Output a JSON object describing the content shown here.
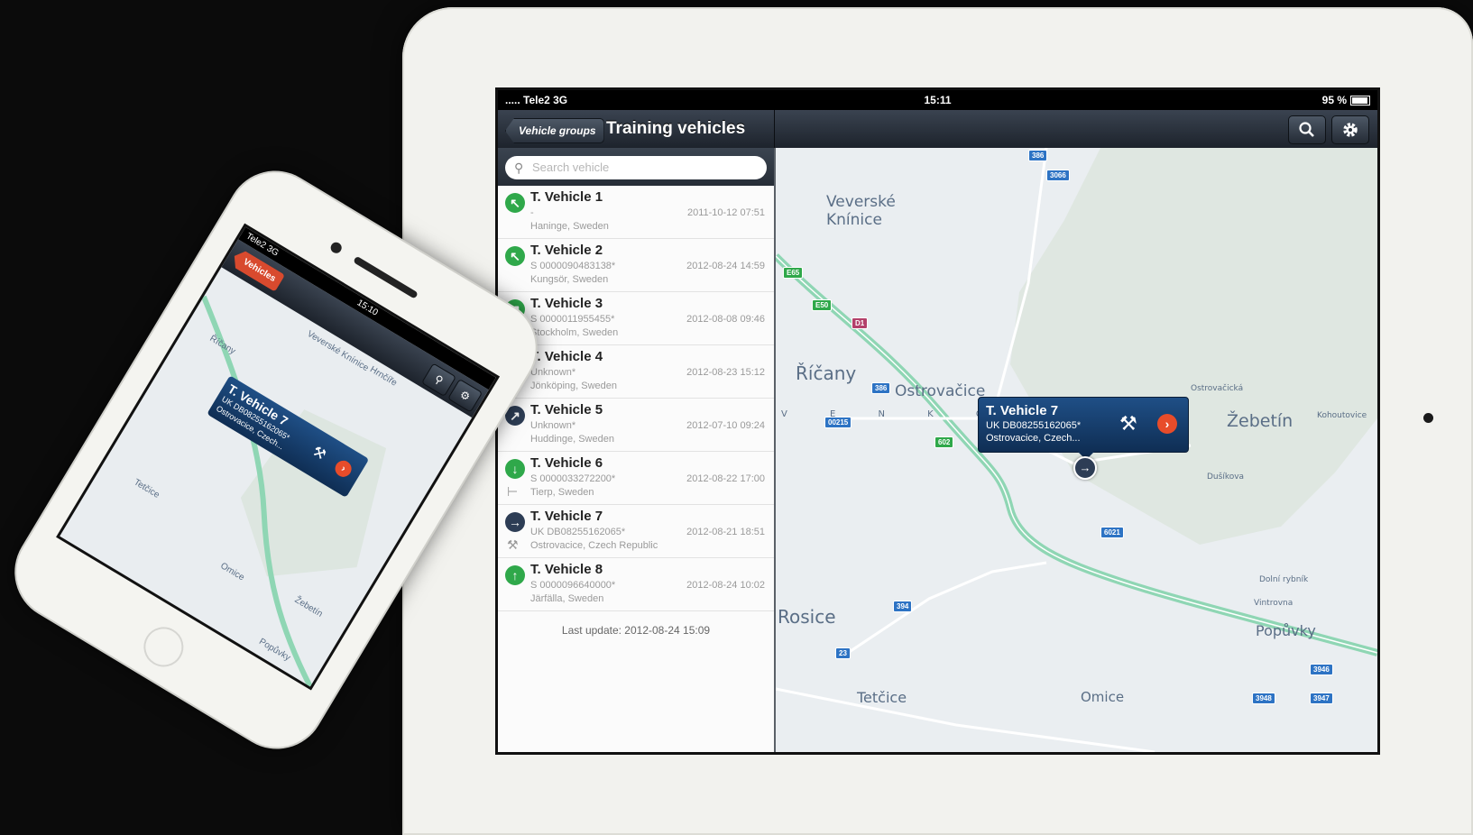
{
  "ipad": {
    "status": {
      "carrier": "..... Tele2  3G",
      "time": "15:11",
      "battery": "95 %"
    },
    "nav": {
      "back_label": "Vehicle groups",
      "title": "Training vehicles",
      "search_icon": "search-icon",
      "settings_icon": "gear-icon"
    },
    "search": {
      "placeholder": "Search vehicle"
    },
    "vehicles": [
      {
        "name": "T. Vehicle 1",
        "reg": "-",
        "time": "2011-10-12 07:51",
        "location": "Haninge, Sweden",
        "color": "#2fa84a",
        "arrow": "↖"
      },
      {
        "name": "T. Vehicle 2",
        "reg": "S 0000090483138*",
        "time": "2012-08-24 14:59",
        "location": "Kungsör, Sweden",
        "color": "#2fa84a",
        "arrow": "↖"
      },
      {
        "name": "T. Vehicle 3",
        "reg": "S 0000011955455*",
        "time": "2012-08-08 09:46",
        "location": "Stockholm, Sweden",
        "color": "#2fa84a",
        "arrow": "↗"
      },
      {
        "name": "T. Vehicle 4",
        "reg": "Unknown*",
        "time": "2012-08-23 15:12",
        "location": "Jönköping, Sweden",
        "color": "#2d3d55",
        "arrow": "←"
      },
      {
        "name": "T. Vehicle 5",
        "reg": "Unknown*",
        "time": "2012-07-10 09:24",
        "location": "Huddinge, Sweden",
        "color": "#2d3d55",
        "arrow": "↗"
      },
      {
        "name": "T. Vehicle 6",
        "reg": "S 0000033272200*",
        "time": "2012-08-22 17:00",
        "location": "Tierp, Sweden",
        "color": "#2fa84a",
        "arrow": "↓"
      },
      {
        "name": "T. Vehicle 7",
        "reg": "UK DB08255162065*",
        "time": "2012-08-21 18:51",
        "location": "Ostrovacice, Czech Republic",
        "color": "#2d3d55",
        "arrow": "→"
      },
      {
        "name": "T. Vehicle 8",
        "reg": "S 0000096640000*",
        "time": "2012-08-24 10:02",
        "location": "Järfälla, Sweden",
        "color": "#2fa84a",
        "arrow": "↑"
      }
    ],
    "last_update": "Last update: 2012-08-24 15:09",
    "map": {
      "places": [
        "Veverské\nKnínice",
        "Říčany",
        "Ostrovačice",
        "Žebetín",
        "Rosice",
        "Tetčice",
        "Omice",
        "Popůvky",
        "V E N K O V",
        "Ostrovačická",
        "Dušíkova",
        "Vintrovna",
        "Kohoutovice",
        "Dolní rybník"
      ],
      "roads": [
        "E65",
        "E50",
        "D1",
        "602",
        "386",
        "3066",
        "386",
        "00215",
        "394",
        "23",
        "6021",
        "3946",
        "3947",
        "3948"
      ],
      "callout": {
        "title": "T. Vehicle 7",
        "reg": "UK DB08255162065*",
        "location": "Ostrovacice, Czech..."
      }
    }
  },
  "iphone": {
    "status": {
      "carrier": "Tele2  3G",
      "time": "15:10"
    },
    "nav": {
      "back_label": "Vehicles"
    },
    "callout": {
      "title": "T. Vehicle 7",
      "reg": "UK DB08255162065*",
      "location": "Ostrovacice, Czech..."
    },
    "places": [
      "Veverské Knínice",
      "Říčany",
      "Omice",
      "Žebetín",
      "Tetčice",
      "Popůvky",
      "Hrnčíře"
    ]
  }
}
